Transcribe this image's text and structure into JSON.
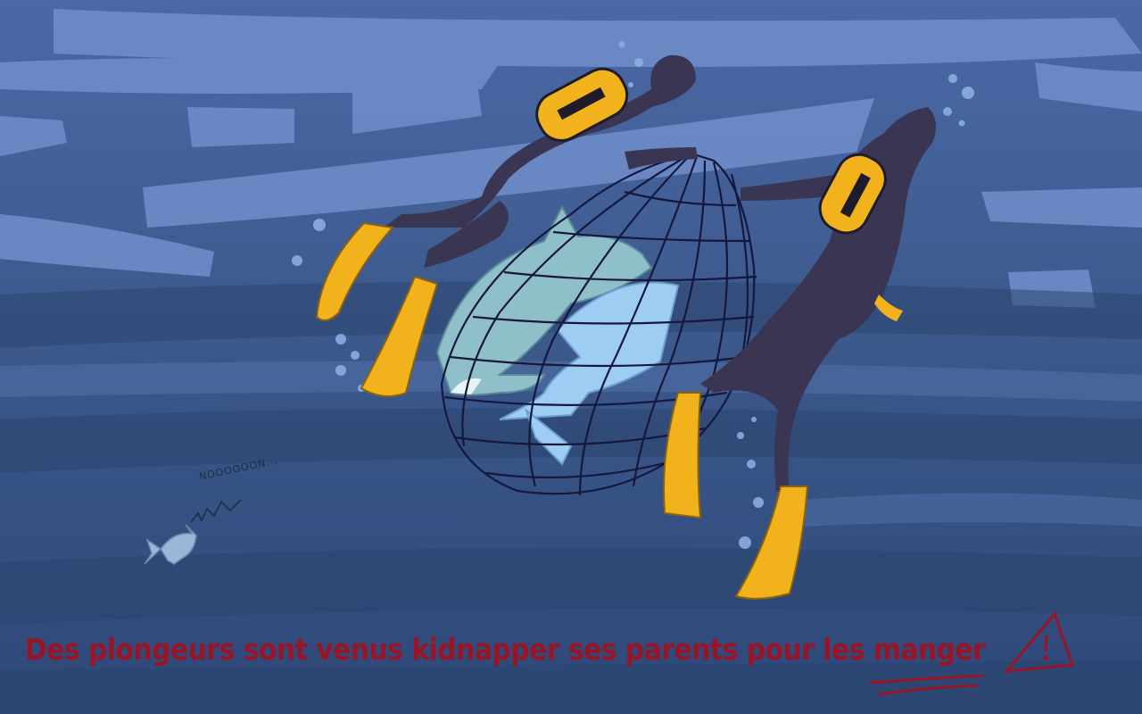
{
  "scene": {
    "caption": {
      "before": "Des plongeurs sont venus kidnapper ses parents pour les ",
      "emphasis": "manger"
    },
    "baby_fish_cry": "NOOOOOON...",
    "colors": {
      "water": "#3d5a8c",
      "water_light": "#6e8cc8",
      "water_dark": "#2c4570",
      "wetsuit": "#3a3553",
      "tank": "#f2b21c",
      "net": "#15183c",
      "shark_light": "#9ecdf3",
      "shark_teal": "#8fc0c9",
      "caption": "#9b1425"
    },
    "icons": [
      "warning-triangle-icon"
    ]
  }
}
